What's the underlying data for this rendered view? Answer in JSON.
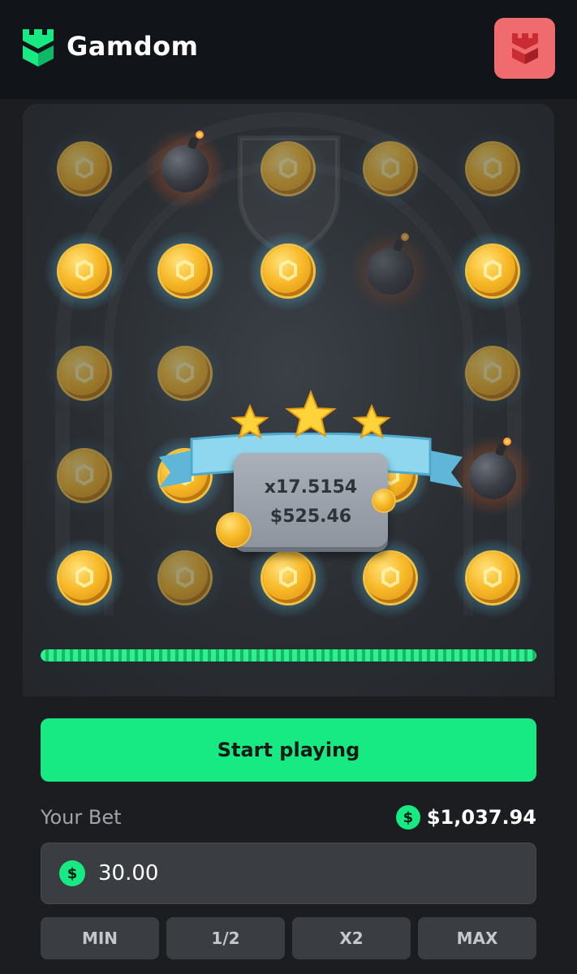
{
  "header": {
    "brand": "Gamdom",
    "brand_color": "#17ea82",
    "logo_icon": "castle-icon",
    "account_icon": "castle-tower-icon",
    "account_color": "#ef6b6e"
  },
  "board": {
    "rows": 5,
    "cols": 5,
    "tiles": [
      [
        "coin-dim",
        "bomb",
        "coin-dim",
        "coin-dim",
        "coin-dim"
      ],
      [
        "coin",
        "coin",
        "coin",
        "bomb-dim",
        "coin"
      ],
      [
        "coin-dim",
        "coin-dim",
        "hidden",
        "hidden",
        "coin-dim"
      ],
      [
        "coin-dim",
        "coin",
        "coin-dim",
        "coin",
        "bomb"
      ],
      [
        "coin",
        "coin-dim",
        "coin",
        "coin",
        "coin"
      ]
    ],
    "win": {
      "multiplier": "x17.5154",
      "amount": "$525.46",
      "stars": 3
    },
    "progress_fraction": 1.0
  },
  "controls": {
    "start_label": "Start playing",
    "bet_label": "Your Bet",
    "balance": "$1,037.94",
    "currency_symbol": "$",
    "bet_value": "30.00",
    "quick_buttons": [
      "MIN",
      "1/2",
      "X2",
      "MAX"
    ],
    "accent_color": "#17ea82"
  }
}
